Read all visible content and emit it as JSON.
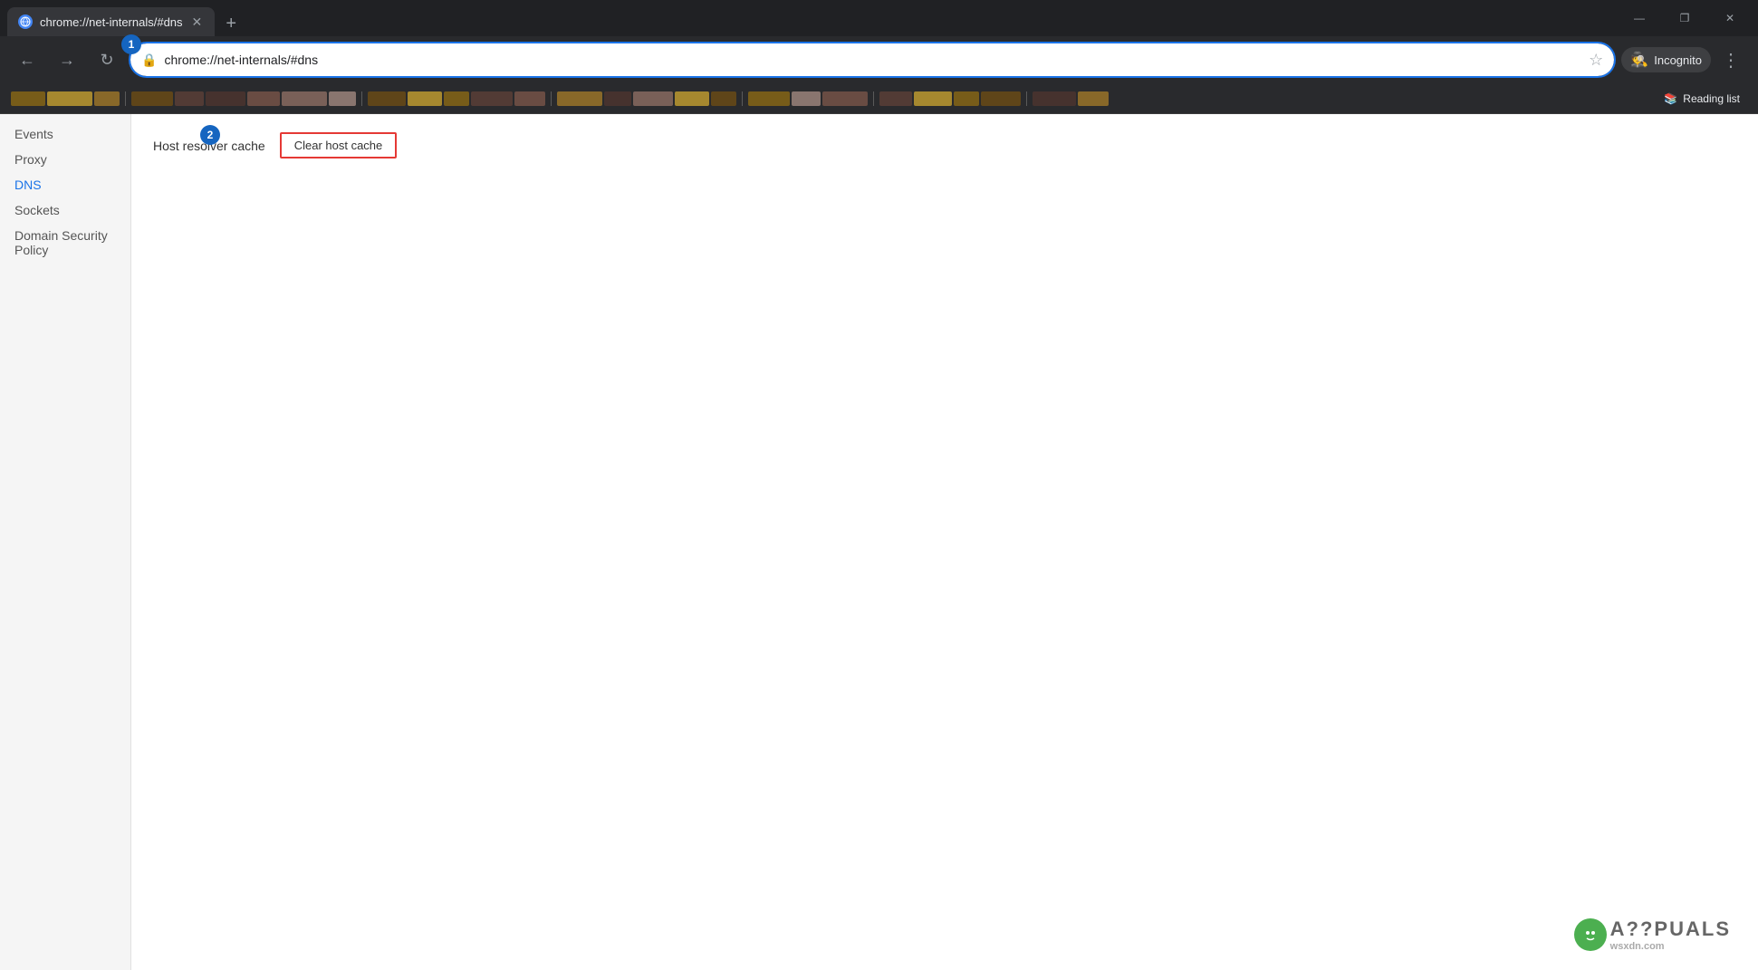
{
  "window": {
    "title": "chrome://net-internals/#dns"
  },
  "titlebar": {
    "tab_title": "chrome://net-internals/#dns",
    "close_btn": "✕",
    "minimize_btn": "—",
    "maximize_btn": "❐",
    "new_tab_btn": "+"
  },
  "navbar": {
    "back_btn": "←",
    "forward_btn": "→",
    "refresh_btn": "↻",
    "address": "chrome://net-internals/#dns",
    "star_btn": "☆",
    "incognito_label": "Incognito",
    "menu_btn": "⋮",
    "reading_list_label": "Reading list"
  },
  "sidebar": {
    "items": [
      {
        "label": "Events",
        "active": false
      },
      {
        "label": "Proxy",
        "active": false
      },
      {
        "label": "DNS",
        "active": true
      },
      {
        "label": "Sockets",
        "active": false
      },
      {
        "label": "Domain Security Policy",
        "active": false
      }
    ]
  },
  "dns_page": {
    "host_resolver_label": "Host resolver cache",
    "clear_cache_btn": "Clear host cache"
  },
  "annotations": {
    "badge1": "1",
    "badge2": "2"
  },
  "watermark": {
    "text": "wsxdn.com"
  }
}
